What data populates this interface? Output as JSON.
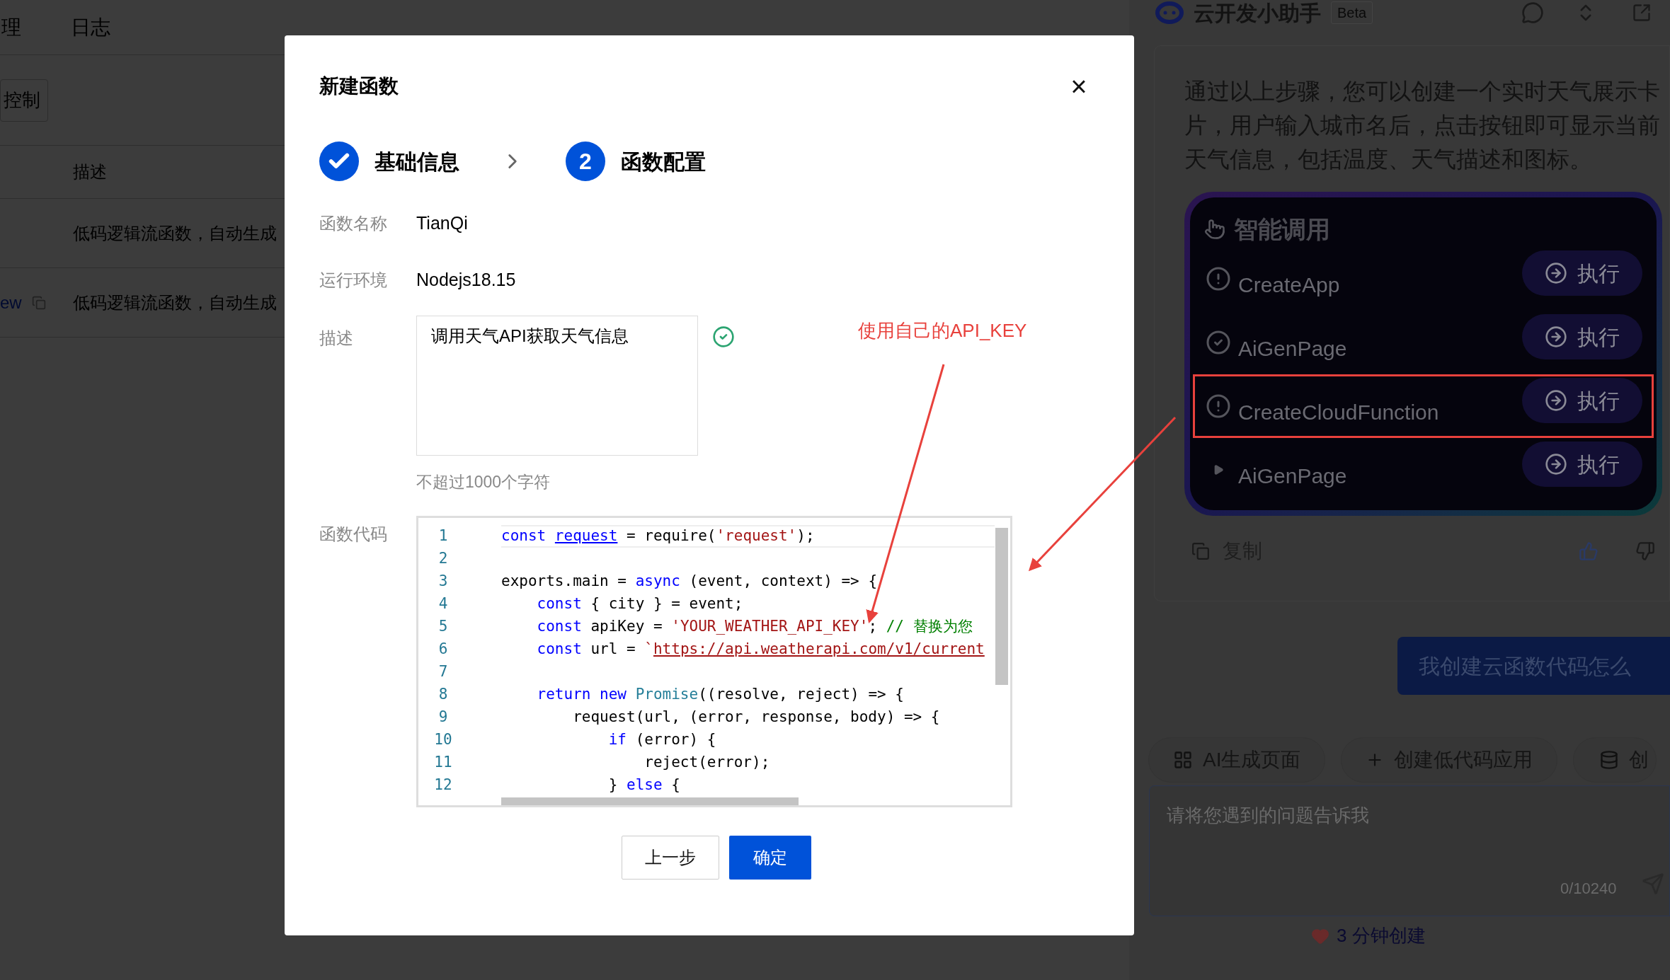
{
  "background_page": {
    "header_items": [
      "理",
      "日志"
    ],
    "control_button": "控制",
    "table": {
      "columns": [
        "描述"
      ],
      "rows": [
        {
          "description": "低码逻辑流函数，自动生成"
        },
        {
          "link": "ew",
          "description": "低码逻辑流函数，自动生成"
        }
      ]
    }
  },
  "dialog": {
    "title": "新建函数",
    "close": "×",
    "steps": [
      {
        "label": "基础信息",
        "completed": true
      },
      {
        "label": "函数配置",
        "completed": false,
        "number": "2"
      }
    ],
    "fields": [
      {
        "label": "函数名称",
        "value": "TianQi"
      },
      {
        "label": "运行环境",
        "value": "Nodejs18.15"
      }
    ],
    "description": {
      "label": "描述",
      "value": "调用天气API获取天气信息",
      "valid": true,
      "hint": "不超过1000个字符"
    },
    "code": {
      "label": "函数代码",
      "lines": [
        {
          "number": "1",
          "tokens": [
            {
              "text": "const ",
              "kind": "keyword"
            },
            {
              "text": "request",
              "kind": "link"
            },
            {
              "text": " = require(",
              "kind": "plain"
            },
            {
              "text": "'request'",
              "kind": "string"
            },
            {
              "text": ");",
              "kind": "plain"
            }
          ]
        },
        {
          "number": "2"
        },
        {
          "number": "3",
          "tokens": [
            {
              "text": "exports.main = ",
              "kind": "plain"
            },
            {
              "text": "async",
              "kind": "keyword"
            },
            {
              "text": " (event, context) => {",
              "kind": "plain"
            }
          ]
        },
        {
          "number": "4",
          "tokens": [
            {
              "text": "    const",
              "kind": "keyword"
            },
            {
              "text": " { city } = event;",
              "kind": "plain"
            }
          ]
        },
        {
          "number": "5",
          "tokens": [
            {
              "text": "    const",
              "kind": "keyword"
            },
            {
              "text": " apiKey = ",
              "kind": "plain"
            },
            {
              "text": "'YOUR_WEATHER_API_KEY'",
              "kind": "string"
            },
            {
              "text": "; ",
              "kind": "plain"
            },
            {
              "text": "// 替换为您",
              "kind": "comment"
            }
          ]
        },
        {
          "number": "6",
          "tokens": [
            {
              "text": "    const",
              "kind": "keyword"
            },
            {
              "text": " url = ",
              "kind": "plain"
            },
            {
              "text": "`",
              "kind": "string"
            },
            {
              "text": "https://api.weatherapi.com/v1/current",
              "kind": "url"
            }
          ]
        },
        {
          "number": "7"
        },
        {
          "number": "8",
          "tokens": [
            {
              "text": "    return new ",
              "kind": "keyword"
            },
            {
              "text": "Promise",
              "kind": "type"
            },
            {
              "text": "((resolve, reject) => {",
              "kind": "plain"
            }
          ]
        },
        {
          "number": "9",
          "tokens": [
            {
              "text": "        request(url, (error, response, body) => {",
              "kind": "plain"
            }
          ]
        },
        {
          "number": "10",
          "tokens": [
            {
              "text": "            if",
              "kind": "keyword"
            },
            {
              "text": " (error) {",
              "kind": "plain"
            }
          ]
        },
        {
          "number": "11",
          "tokens": [
            {
              "text": "                reject(error);",
              "kind": "plain"
            }
          ]
        },
        {
          "number": "12",
          "tokens": [
            {
              "text": "            } ",
              "kind": "plain"
            },
            {
              "text": "else",
              "kind": "keyword"
            },
            {
              "text": " {",
              "kind": "plain"
            }
          ]
        }
      ]
    },
    "buttons": [
      {
        "label": "上一步",
        "kind": "secondary"
      },
      {
        "label": "确定",
        "kind": "primary"
      }
    ]
  },
  "annotation": {
    "note": "使用自己的API_KEY"
  },
  "assistant": {
    "title": "云开发小助手",
    "badge": "Beta",
    "message": "通过以上步骤，您可以创建一个实时天气展示卡片，用户输入城市名后，点击按钮即可显示当前天气信息，包括温度、天气描述和图标。",
    "tool_card": {
      "title": "智能调用",
      "items": [
        {
          "name": "CreateApp",
          "kind": "warning",
          "button": "执行",
          "highlighted": false
        },
        {
          "name": "AiGenPage",
          "kind": "done",
          "button": "执行",
          "highlighted": false
        },
        {
          "name": "CreateCloudFunction",
          "kind": "warning",
          "button": "执行",
          "highlighted": true
        },
        {
          "name": "AiGenPage",
          "kind": "collapsed",
          "button": "执行",
          "highlighted": false
        }
      ]
    },
    "copy": "复制",
    "user_message": "我创建云函数代码怎么",
    "chips": [
      {
        "label": "AI生成页面",
        "kind": "grid"
      },
      {
        "label": "创建低代码应用",
        "kind": "plus"
      },
      {
        "label": "创",
        "kind": "database"
      }
    ],
    "input": {
      "placeholder": "请将您遇到的问题告诉我",
      "counter": "0/10240"
    },
    "footer": "3 分钟创建"
  }
}
